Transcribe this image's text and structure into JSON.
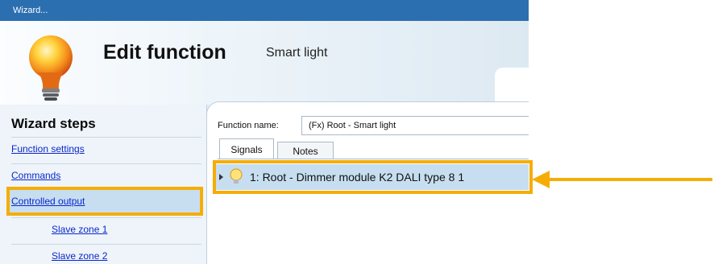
{
  "window": {
    "title": "Wizard..."
  },
  "header": {
    "title": "Edit function",
    "subtitle": "Smart light",
    "icon": "lightbulb-icon"
  },
  "sidebar": {
    "title": "Wizard steps",
    "items": [
      {
        "label": "Function settings"
      },
      {
        "label": "Commands"
      },
      {
        "label": "Controlled output"
      }
    ],
    "subitems": [
      {
        "label": "Slave zone 1"
      },
      {
        "label": "Slave zone 2"
      }
    ]
  },
  "main": {
    "function_name_label": "Function name:",
    "function_name_value": "(Fx) Root - Smart light",
    "tabs": [
      {
        "label": "Signals"
      },
      {
        "label": "Notes"
      }
    ],
    "rows": [
      {
        "text": "1: Root - Dimmer module K2  DALI type 8 1",
        "icon": "lightbulb-icon"
      }
    ]
  },
  "annotations": {
    "highlight_color": "#f5ad06"
  }
}
